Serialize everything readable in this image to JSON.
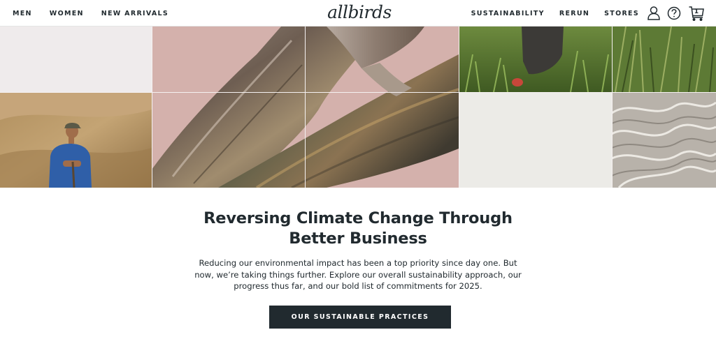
{
  "header": {
    "logo_text": "allbirds",
    "nav_left": [
      "MEN",
      "WOMEN",
      "NEW ARRIVALS"
    ],
    "nav_right": [
      "SUSTAINABILITY",
      "RERUN",
      "STORES"
    ],
    "icons": [
      "account-icon",
      "help-icon",
      "cart-icon"
    ],
    "cart_count": "1"
  },
  "hero": {
    "tiles": [
      "plain-light",
      "eucalyptus-bark",
      "grass-boot",
      "grass",
      "shepherd-hillside",
      "plain-light",
      "wool-fibers"
    ]
  },
  "content": {
    "headline": "Reversing Climate Change Through Better Business",
    "body": "Reducing our environmental impact has been a top priority since day one. But now, we’re taking things further. Explore our overall sustainability approach, our progress thus far, and our bold list of commitments for 2025.",
    "cta_label": "OUR SUSTAINABLE PRACTICES"
  },
  "colors": {
    "text": "#212a2f",
    "cta_background": "#212a2f",
    "cta_text": "#ffffff",
    "hero_pink": "#d4b1ac"
  }
}
